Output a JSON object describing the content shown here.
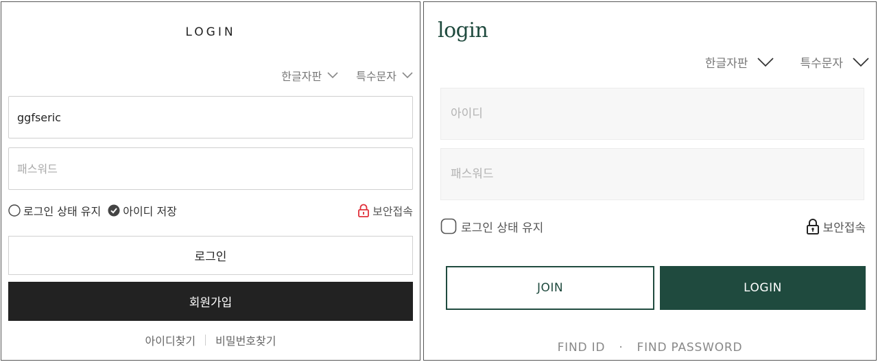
{
  "left": {
    "title": "LOGIN",
    "keyboard_korean": "한글자판",
    "keyboard_special": "특수문자",
    "id_value": "ggfseric",
    "password_placeholder": "패스워드",
    "keep_login_label": "로그인 상태 유지",
    "save_id_label": "아이디 저장",
    "secure_label": "보안접속",
    "login_button": "로그인",
    "join_button": "회원가입",
    "find_id": "아이디찾기",
    "find_password": "비밀번호찾기",
    "colors": {
      "secure_icon": "#e0303a",
      "join_bg": "#222222"
    }
  },
  "right": {
    "title": "login",
    "keyboard_korean": "한글자판",
    "keyboard_special": "특수문자",
    "id_placeholder": "아이디",
    "password_placeholder": "패스워드",
    "keep_login_label": "로그인 상태 유지",
    "secure_label": "보안접속",
    "join_button": "JOIN",
    "login_button": "LOGIN",
    "find_id": "FIND ID",
    "separator": "·",
    "find_password": "FIND PASSWORD",
    "colors": {
      "brand": "#1f4a3e"
    }
  }
}
